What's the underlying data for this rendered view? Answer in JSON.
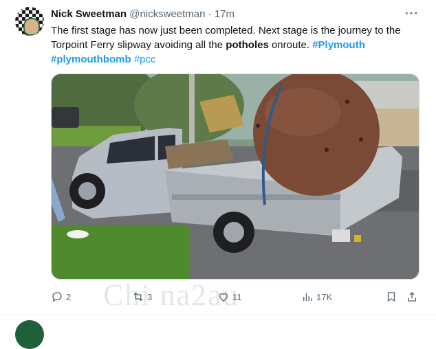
{
  "tweet": {
    "author_name": "Nick Sweetman",
    "handle": "@nicksweetman",
    "separator": "·",
    "time": "17m",
    "more_label": "···",
    "text": {
      "part1": "The first stage has now just been completed. Next stage is the journey to the Torpoint Ferry slipway avoiding all the ",
      "bold_word": "potholes",
      "part2": " onroute. ",
      "hashtag1": "#Plymouth",
      "hashtag2": "#plymouthbomb",
      "hashtag3": "#pcc"
    }
  },
  "actions": {
    "replies": "2",
    "reposts": "3",
    "likes": "11",
    "views": "17K"
  },
  "watermark": "Chi na2au",
  "icons": {
    "reply": "reply-icon",
    "repost": "repost-icon",
    "like": "heart-icon",
    "views": "views-icon",
    "bookmark": "bookmark-icon",
    "share": "share-icon",
    "more": "more-icon"
  },
  "colors": {
    "link": "#1d9bf0",
    "secondary_text": "#536471",
    "primary_text": "#0f1419"
  }
}
